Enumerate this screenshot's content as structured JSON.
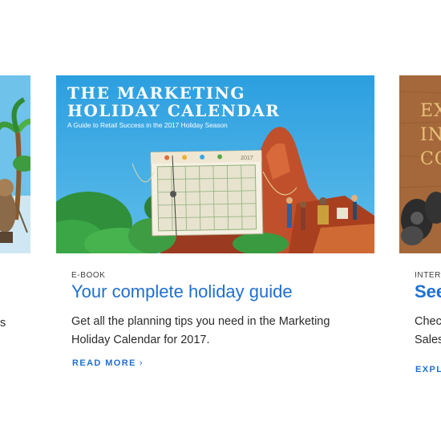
{
  "cards": {
    "left": {
      "desc_fragment": "s"
    },
    "center": {
      "hero_title_line1": "THE MARKETING",
      "hero_title_line2": "HOLIDAY CALENDAR",
      "hero_subtitle": "A Guide to Retail Success in the 2017 Holiday Season",
      "calendar_year": "2017",
      "eyebrow": "E-BOOK",
      "title": "Your complete holiday guide",
      "description": "Get all the planning tips you need in the Marketing Holiday Calendar for 2017.",
      "cta": "READ MORE",
      "cta_icon": "chevron-right-icon"
    },
    "right": {
      "cover_lines": [
        "EX",
        "IN",
        "CO"
      ],
      "eyebrow": "INTER",
      "title": "See",
      "desc_line1": "Chec",
      "desc_line2": "Sales",
      "cta": "EXPL"
    }
  },
  "colors": {
    "link": "#1f6fd0",
    "sky": "#3aa6e0",
    "text": "#2b2b2b"
  }
}
